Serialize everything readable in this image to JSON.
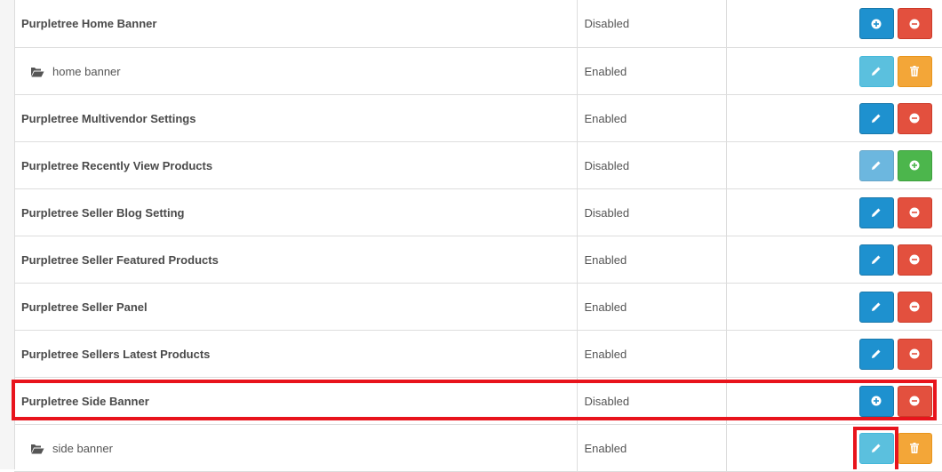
{
  "colors": {
    "primary": "#1e91cf",
    "danger": "#e3503e",
    "info": "#5bc0de",
    "warning": "#f3a638",
    "success": "#4cb64c",
    "highlight": "#e8141c"
  },
  "rows": [
    {
      "name": "Purpletree Home Banner",
      "status": "Disabled",
      "level": "parent",
      "actions": [
        "install-icon",
        "uninstall-icon"
      ]
    },
    {
      "name": "home banner",
      "status": "Enabled",
      "level": "child",
      "actions": [
        "edit-icon",
        "delete-icon"
      ]
    },
    {
      "name": "Purpletree Multivendor Settings",
      "status": "Enabled",
      "level": "parent",
      "actions": [
        "edit-icon",
        "uninstall-icon"
      ]
    },
    {
      "name": "Purpletree Recently View Products",
      "status": "Disabled",
      "level": "parent",
      "actions": [
        "edit-icon (disabled)",
        "install-icon"
      ]
    },
    {
      "name": "Purpletree Seller Blog Setting",
      "status": "Disabled",
      "level": "parent",
      "actions": [
        "edit-icon",
        "uninstall-icon"
      ]
    },
    {
      "name": "Purpletree Seller Featured Products",
      "status": "Enabled",
      "level": "parent",
      "actions": [
        "edit-icon",
        "uninstall-icon"
      ]
    },
    {
      "name": "Purpletree Seller Panel",
      "status": "Enabled",
      "level": "parent",
      "actions": [
        "edit-icon",
        "uninstall-icon"
      ]
    },
    {
      "name": "Purpletree Sellers Latest Products",
      "status": "Enabled",
      "level": "parent",
      "actions": [
        "edit-icon",
        "uninstall-icon"
      ]
    },
    {
      "name": "Purpletree Side Banner",
      "status": "Disabled",
      "level": "parent",
      "actions": [
        "install-icon",
        "uninstall-icon"
      ],
      "highlighted": true
    },
    {
      "name": "side banner",
      "status": "Enabled",
      "level": "child",
      "actions": [
        "edit-icon",
        "delete-icon"
      ],
      "edit_highlighted": true
    }
  ]
}
